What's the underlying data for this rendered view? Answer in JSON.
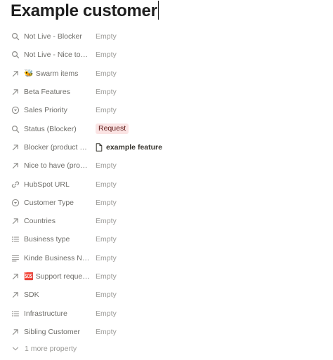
{
  "page": {
    "title": "Example customer"
  },
  "properties": [
    {
      "icon": "search-icon",
      "label": "Not Live - Blocker",
      "value": "Empty",
      "type": "empty"
    },
    {
      "icon": "search-icon",
      "label": "Not Live - Nice to…",
      "value": "Empty",
      "type": "empty"
    },
    {
      "icon": "arrow-up-right-icon",
      "emoji": "🐝",
      "label": "Swarm items",
      "value": "Empty",
      "type": "empty"
    },
    {
      "icon": "arrow-up-right-icon",
      "label": "Beta Features",
      "value": "Empty",
      "type": "empty"
    },
    {
      "icon": "status-icon",
      "label": "Sales Priority",
      "value": "Empty",
      "type": "empty"
    },
    {
      "icon": "search-icon",
      "label": "Status (Blocker)",
      "value": "Request",
      "type": "tag",
      "tag_bg": "#fbe4e4",
      "tag_color": "#5d1715"
    },
    {
      "icon": "arrow-up-right-icon",
      "label": "Blocker (product …",
      "value": "example feature",
      "type": "relation"
    },
    {
      "icon": "arrow-up-right-icon",
      "label": "Nice to have (pro…",
      "value": "Empty",
      "type": "empty"
    },
    {
      "icon": "link-icon",
      "label": "HubSpot URL",
      "value": "Empty",
      "type": "empty"
    },
    {
      "icon": "status-icon",
      "label": "Customer Type",
      "value": "Empty",
      "type": "empty"
    },
    {
      "icon": "arrow-up-right-icon",
      "label": "Countries",
      "value": "Empty",
      "type": "empty"
    },
    {
      "icon": "list-icon",
      "label": "Business type",
      "value": "Empty",
      "type": "empty"
    },
    {
      "icon": "text-lines-icon",
      "label": "Kinde Business N…",
      "value": "Empty",
      "type": "empty"
    },
    {
      "icon": "arrow-up-right-icon",
      "emoji": "🆘",
      "label": "Support reque…",
      "value": "Empty",
      "type": "empty"
    },
    {
      "icon": "arrow-up-right-icon",
      "label": "SDK",
      "value": "Empty",
      "type": "empty"
    },
    {
      "icon": "list-icon",
      "label": "Infrastructure",
      "value": "Empty",
      "type": "empty"
    },
    {
      "icon": "arrow-up-right-icon",
      "label": "Sibling Customer",
      "value": "Empty",
      "type": "empty"
    }
  ],
  "more_properties": {
    "icon": "chevron-down-icon",
    "label": "1 more property"
  },
  "colors": {
    "label": "#6e6d69",
    "empty_value": "#9b9a97",
    "title": "#1f1f1f",
    "icon": "#8f8e8b"
  }
}
